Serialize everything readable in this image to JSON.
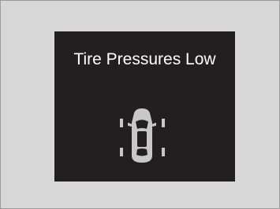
{
  "warning": {
    "message": "Tire Pressures Low",
    "icon": "car-top-view-tpms-icon"
  },
  "colors": {
    "outer_background": "#d7d7d7",
    "outer_border": "#9a9a9a",
    "screen_background": "#231f20",
    "text": "#ffffff",
    "car_fill": "#c8c8c8"
  }
}
